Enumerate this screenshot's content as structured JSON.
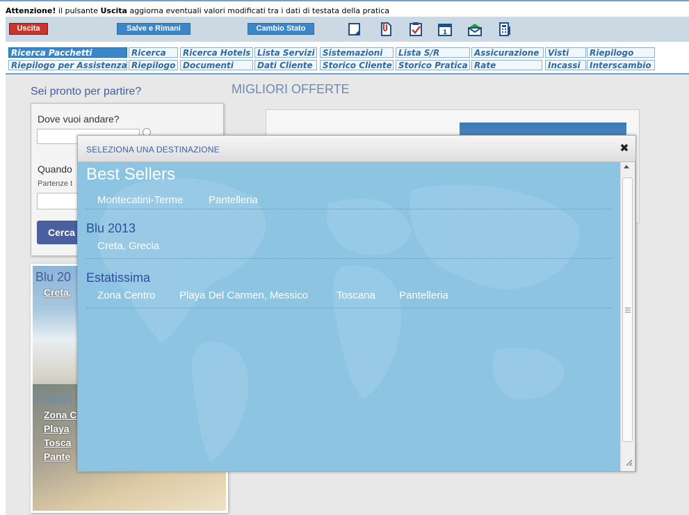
{
  "notice": {
    "bold1": "Attenzione!",
    "text1": " il pulsante ",
    "bold2": "Uscita",
    "text2": " aggiorna eventuali valori modificati tra i dati di testata della pratica"
  },
  "toolbar": {
    "buttons": [
      {
        "label": "Uscita",
        "color": "#c8352a"
      },
      {
        "label": "Salve e Rimani",
        "color": "#3a86c8"
      },
      {
        "label": "Cambio Stato",
        "color": "#3a86c8"
      }
    ],
    "icons": [
      "note-icon",
      "attachment-icon",
      "checklist-icon",
      "calendar-icon",
      "mail-icon",
      "print-icon"
    ]
  },
  "tabs": {
    "row1": [
      "Ricerca Pacchetti",
      "Ricerca",
      "Ricerca Hotels",
      "Lista Servizi",
      "Sistemazioni",
      "Lista S/R",
      "Assicurazione",
      "Visti",
      "Riepilogo"
    ],
    "row2": [
      "Riepilogo per Assistenza",
      "Riepilogo",
      "Documenti",
      "Dati Cliente",
      "Storico Cliente",
      "Storico Pratica",
      "Rate",
      "Incassi",
      "Interscambio"
    ],
    "active": "Ricerca Pacchetti"
  },
  "search": {
    "heading": "Sei pronto per partire?",
    "dove_label": "Dove vuoi andare?",
    "quando_label": "Quando",
    "partenze_label": "Partenze t",
    "cerca_label": "Cerca"
  },
  "offers": {
    "heading": "MIGLIORI OFFERTE"
  },
  "promo": {
    "title": "Blu 20",
    "link1": "Creta,",
    "title2": "Estatis",
    "links": [
      "Zona C",
      "Playa",
      "Tosca",
      "Pante"
    ]
  },
  "modal": {
    "title": "SELEZIONA UNA DESTINAZIONE",
    "close_symbol": "✖",
    "sections": [
      {
        "title": "Best Sellers",
        "destinations": [
          "Montecatini-Terme",
          "Pantelleria"
        ]
      },
      {
        "title": "Blu 2013",
        "destinations": [
          "Creta, Grecia"
        ]
      },
      {
        "title": "Estatissima",
        "destinations": [
          "Zona Centro",
          "Playa Del Carmen, Messico",
          "Toscana",
          "Pantelleria"
        ]
      }
    ]
  },
  "colors": {
    "accent": "#3a86c8",
    "modal_bg": "#8cc4e2",
    "heading_blue": "#3c5fa0"
  }
}
